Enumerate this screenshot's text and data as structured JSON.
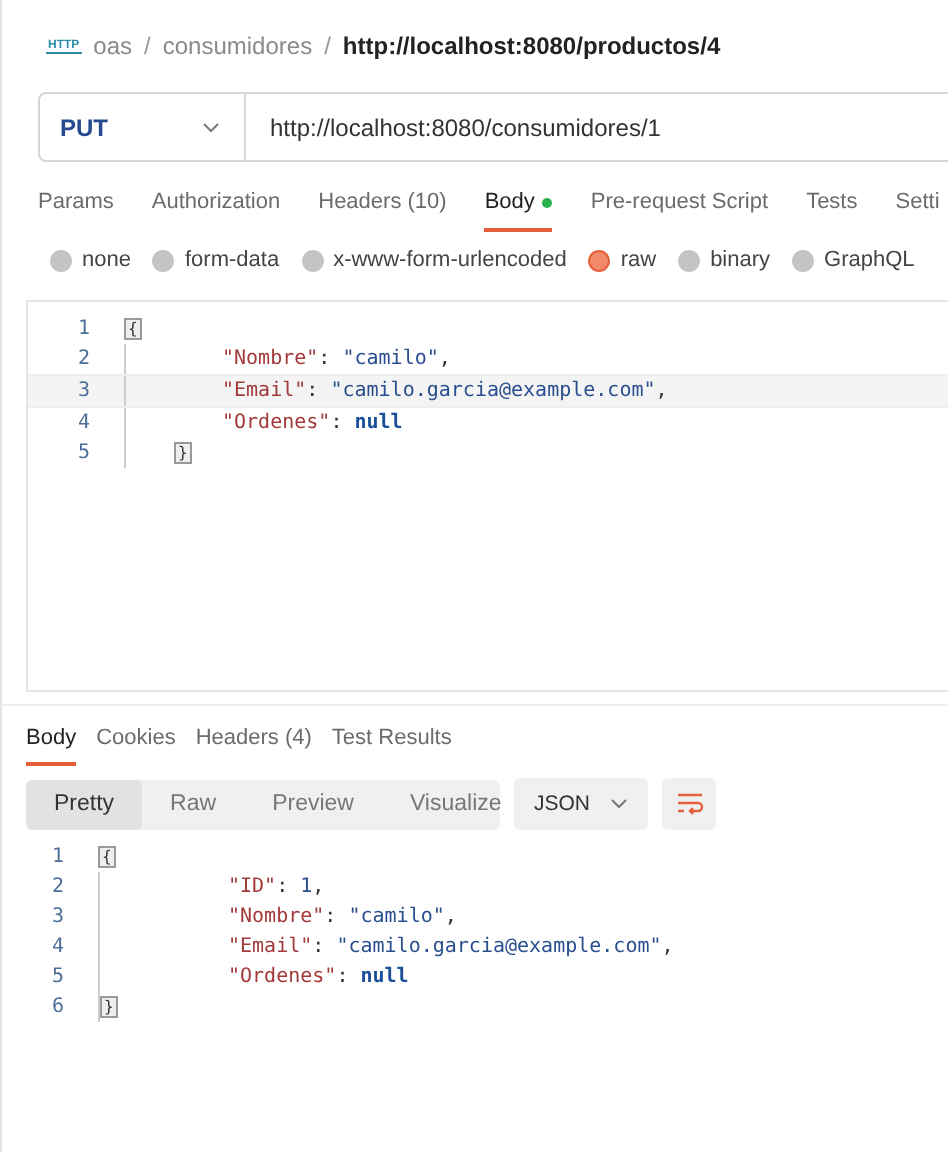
{
  "breadcrumb": {
    "badge": "HTTP",
    "parts": [
      "oas",
      "consumidores"
    ],
    "separator": "/",
    "current": "http://localhost:8080/productos/4"
  },
  "request": {
    "method": "PUT",
    "url": "http://localhost:8080/consumidores/1"
  },
  "tabs": [
    {
      "label": "Params",
      "selected": false
    },
    {
      "label": "Authorization",
      "selected": false
    },
    {
      "label": "Headers",
      "count": "(10)",
      "selected": false
    },
    {
      "label": "Body",
      "selected": true,
      "dot": true
    },
    {
      "label": "Pre-request Script",
      "selected": false
    },
    {
      "label": "Tests",
      "selected": false
    },
    {
      "label": "Setti",
      "selected": false
    }
  ],
  "body_types": [
    {
      "label": "none",
      "selected": false
    },
    {
      "label": "form-data",
      "selected": false
    },
    {
      "label": "x-www-form-urlencoded",
      "selected": false
    },
    {
      "label": "raw",
      "selected": true
    },
    {
      "label": "binary",
      "selected": false
    },
    {
      "label": "GraphQL",
      "selected": false
    }
  ],
  "request_body": [
    {
      "number": "1",
      "kind": "brace",
      "active": false,
      "tokens": [
        {
          "kind": "bracket",
          "text": "{"
        }
      ]
    },
    {
      "number": "2",
      "kind": "member",
      "active": false,
      "tokens": [
        {
          "kind": "key",
          "text": "\"Nombre\""
        },
        {
          "kind": "punct",
          "text": ": "
        },
        {
          "kind": "string",
          "text": "\"camilo\""
        },
        {
          "kind": "punct",
          "text": ","
        }
      ]
    },
    {
      "number": "3",
      "kind": "member",
      "active": true,
      "tokens": [
        {
          "kind": "key",
          "text": "\"Email\""
        },
        {
          "kind": "punct",
          "text": ": "
        },
        {
          "kind": "string",
          "text": "\"camilo.garcia@example.com\""
        },
        {
          "kind": "punct",
          "text": ","
        }
      ]
    },
    {
      "number": "4",
      "kind": "member",
      "active": false,
      "tokens": [
        {
          "kind": "key",
          "text": "\"Ordenes\""
        },
        {
          "kind": "punct",
          "text": ": "
        },
        {
          "kind": "keyword",
          "text": "null"
        }
      ]
    },
    {
      "number": "5",
      "kind": "close",
      "active": false,
      "tokens": [
        {
          "kind": "bracket",
          "text": "}"
        }
      ]
    }
  ],
  "response_tabs": [
    {
      "label": "Body",
      "selected": true
    },
    {
      "label": "Cookies",
      "selected": false
    },
    {
      "label": "Headers",
      "count": "(4)",
      "selected": false
    },
    {
      "label": "Test Results",
      "selected": false
    }
  ],
  "view_modes": [
    {
      "label": "Pretty",
      "selected": true
    },
    {
      "label": "Raw",
      "selected": false
    },
    {
      "label": "Preview",
      "selected": false
    },
    {
      "label": "Visualize",
      "selected": false
    }
  ],
  "format": "JSON",
  "response_body": [
    {
      "number": "1",
      "kind": "brace",
      "tokens": [
        {
          "kind": "bracket",
          "text": "{"
        }
      ]
    },
    {
      "number": "2",
      "kind": "member",
      "tokens": [
        {
          "kind": "key",
          "text": "\"ID\""
        },
        {
          "kind": "punct",
          "text": ": "
        },
        {
          "kind": "number",
          "text": "1"
        },
        {
          "kind": "punct",
          "text": ","
        }
      ]
    },
    {
      "number": "3",
      "kind": "member",
      "tokens": [
        {
          "kind": "key",
          "text": "\"Nombre\""
        },
        {
          "kind": "punct",
          "text": ": "
        },
        {
          "kind": "string",
          "text": "\"camilo\""
        },
        {
          "kind": "punct",
          "text": ","
        }
      ]
    },
    {
      "number": "4",
      "kind": "member",
      "tokens": [
        {
          "kind": "key",
          "text": "\"Email\""
        },
        {
          "kind": "punct",
          "text": ": "
        },
        {
          "kind": "string",
          "text": "\"camilo.garcia@example.com\""
        },
        {
          "kind": "punct",
          "text": ","
        }
      ]
    },
    {
      "number": "5",
      "kind": "member",
      "tokens": [
        {
          "kind": "key",
          "text": "\"Ordenes\""
        },
        {
          "kind": "punct",
          "text": ": "
        },
        {
          "kind": "keyword",
          "text": "null"
        }
      ]
    },
    {
      "number": "6",
      "kind": "close",
      "tokens": [
        {
          "kind": "bracket",
          "text": "}"
        }
      ]
    }
  ]
}
